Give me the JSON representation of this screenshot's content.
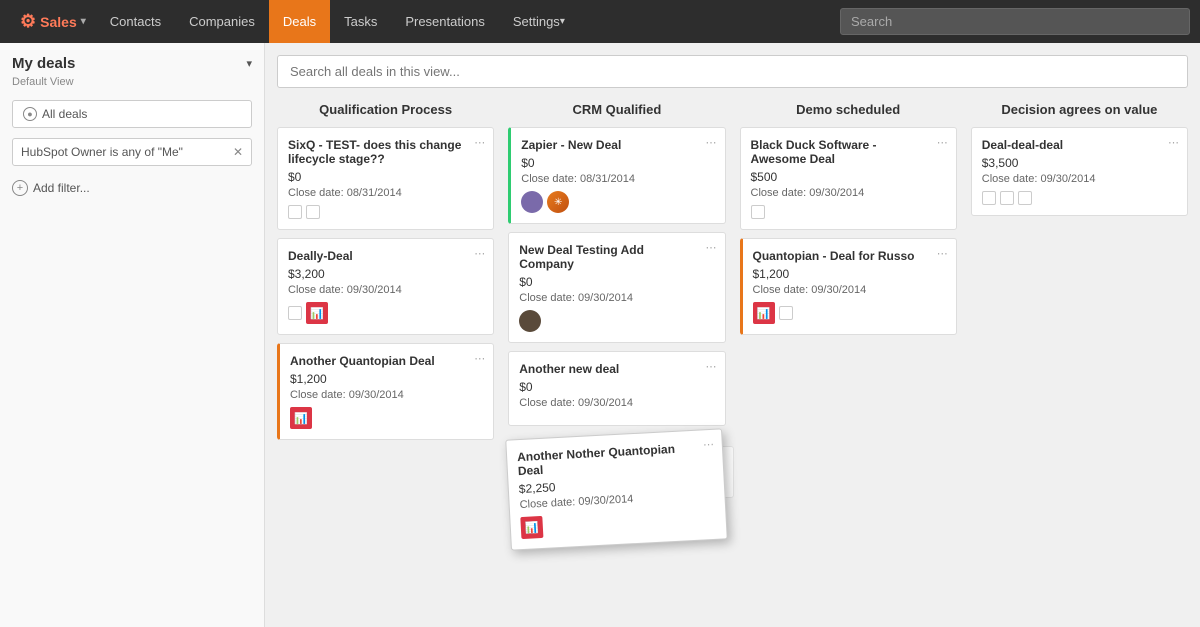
{
  "nav": {
    "logo_text": "Sales",
    "items": [
      {
        "label": "Contacts",
        "active": false
      },
      {
        "label": "Companies",
        "active": false
      },
      {
        "label": "Deals",
        "active": true
      },
      {
        "label": "Tasks",
        "active": false
      },
      {
        "label": "Presentations",
        "active": false
      },
      {
        "label": "Settings",
        "active": false,
        "has_arrow": true
      }
    ],
    "search_placeholder": "Search"
  },
  "sidebar": {
    "title": "My deals",
    "subtitle": "Default View",
    "all_deals_label": "All deals",
    "filter_label": "HubSpot Owner is any of \"Me\"",
    "add_filter_label": "Add filter..."
  },
  "board": {
    "search_placeholder": "Search all deals in this view...",
    "columns": [
      {
        "id": "qualification",
        "header": "Qualification Process",
        "cards": [
          {
            "title": "SixQ - TEST- does this change lifecycle stage??",
            "amount": "$0",
            "close_date": "Close date: 08/31/2014",
            "icons": [
              "checkbox",
              "checkbox"
            ],
            "border": ""
          },
          {
            "title": "Deally-Deal",
            "amount": "$3,200",
            "close_date": "Close date: 09/30/2014",
            "icons": [
              "checkbox",
              "chart"
            ],
            "border": ""
          },
          {
            "title": "Another Quantopian Deal",
            "amount": "$1,200",
            "close_date": "Close date: 09/30/2014",
            "icons": [
              "chart"
            ],
            "border": "orange"
          }
        ]
      },
      {
        "id": "crm",
        "header": "CRM Qualified",
        "cards": [
          {
            "title": "Zapier - New Deal",
            "amount": "$0",
            "close_date": "Close date: 08/31/2014",
            "icons": [
              "avatar-person",
              "avatar-orange"
            ],
            "border": "green"
          },
          {
            "title": "New Deal Testing Add Company",
            "amount": "$0",
            "close_date": "Close date: 09/30/2014",
            "icons": [
              "avatar-dark"
            ],
            "border": ""
          },
          {
            "title": "Another new deal",
            "amount": "$0",
            "close_date": "Close date: 09/30/2014",
            "icons": [],
            "border": ""
          }
        ]
      },
      {
        "id": "demo",
        "header": "Demo scheduled",
        "cards": [
          {
            "title": "Black Duck Software - Awesome Deal",
            "amount": "$500",
            "close_date": "Close date: 09/30/2014",
            "icons": [
              "checkbox"
            ],
            "border": ""
          },
          {
            "title": "Quantopian - Deal for Russo",
            "amount": "$1,200",
            "close_date": "Close date: 09/30/2014",
            "icons": [
              "chart",
              "checkbox"
            ],
            "border": "orange"
          }
        ]
      },
      {
        "id": "decision",
        "header": "Decision agrees on value",
        "cards": [
          {
            "title": "Deal-deal-deal",
            "amount": "$3,500",
            "close_date": "Close date: 09/30/2014",
            "icons": [
              "checkbox",
              "checkbox",
              "checkbox"
            ],
            "border": ""
          }
        ]
      }
    ],
    "dragging_card": {
      "title": "Another Nother Quantopian Deal",
      "amount": "$2,250",
      "close_date": "Close date: 09/30/2014",
      "icon": "chart"
    }
  }
}
